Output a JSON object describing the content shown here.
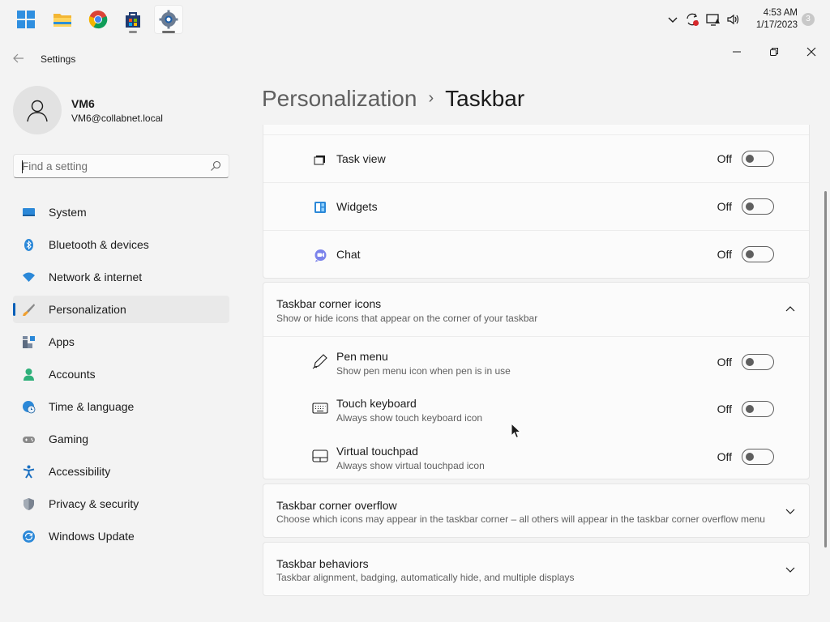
{
  "taskbar": {
    "apps": [
      {
        "name": "start-icon"
      },
      {
        "name": "file-explorer-icon"
      },
      {
        "name": "chrome-icon"
      },
      {
        "name": "store-icon"
      },
      {
        "name": "settings-app-icon"
      }
    ],
    "time": "4:53 AM",
    "date": "1/17/2023",
    "notification_count": "3"
  },
  "window": {
    "title": "Settings"
  },
  "profile": {
    "name": "VM6",
    "email": "VM6@collabnet.local"
  },
  "search": {
    "placeholder": "Find a setting"
  },
  "sidebar": {
    "items": [
      {
        "label": "System",
        "icon": "system-icon"
      },
      {
        "label": "Bluetooth & devices",
        "icon": "bluetooth-icon"
      },
      {
        "label": "Network & internet",
        "icon": "wifi-icon"
      },
      {
        "label": "Personalization",
        "icon": "brush-icon",
        "selected": true
      },
      {
        "label": "Apps",
        "icon": "apps-icon"
      },
      {
        "label": "Accounts",
        "icon": "accounts-icon"
      },
      {
        "label": "Time & language",
        "icon": "globe-clock-icon"
      },
      {
        "label": "Gaming",
        "icon": "gamepad-icon"
      },
      {
        "label": "Accessibility",
        "icon": "accessibility-icon"
      },
      {
        "label": "Privacy & security",
        "icon": "shield-icon"
      },
      {
        "label": "Windows Update",
        "icon": "update-icon"
      }
    ]
  },
  "header": {
    "breadcrumb": "Personalization",
    "separator": "›",
    "current": "Taskbar"
  },
  "taskbar_items": [
    {
      "label": "Task view",
      "state": "Off",
      "icon": "task-view-icon"
    },
    {
      "label": "Widgets",
      "state": "Off",
      "icon": "widgets-icon"
    },
    {
      "label": "Chat",
      "state": "Off",
      "icon": "chat-icon"
    }
  ],
  "corner_icons": {
    "title": "Taskbar corner icons",
    "subtitle": "Show or hide icons that appear on the corner of your taskbar",
    "items": [
      {
        "label": "Pen menu",
        "sub": "Show pen menu icon when pen is in use",
        "state": "Off",
        "icon": "pen-icon"
      },
      {
        "label": "Touch keyboard",
        "sub": "Always show touch keyboard icon",
        "state": "Off",
        "icon": "keyboard-icon"
      },
      {
        "label": "Virtual touchpad",
        "sub": "Always show virtual touchpad icon",
        "state": "Off",
        "icon": "touchpad-icon"
      }
    ]
  },
  "corner_overflow": {
    "title": "Taskbar corner overflow",
    "subtitle": "Choose which icons may appear in the taskbar corner – all others will appear in the taskbar corner overflow menu"
  },
  "behaviors": {
    "title": "Taskbar behaviors",
    "subtitle": "Taskbar alignment, badging, automatically hide, and multiple displays"
  },
  "colors": {
    "accent": "#005fb8",
    "background": "#f3f3f3",
    "card": "#fbfbfb"
  }
}
